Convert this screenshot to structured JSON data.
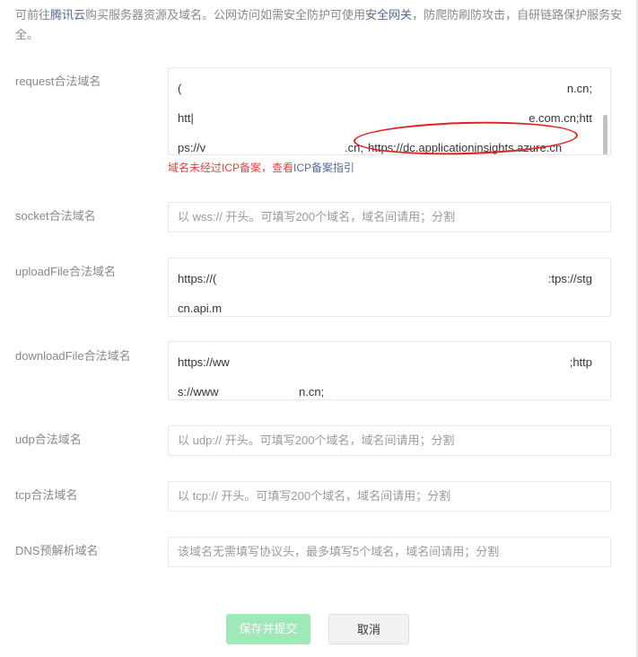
{
  "notice": {
    "prefix": "可前往",
    "link1": "腾讯云",
    "middle": "购买服务器资源及域名。公网访问如需安全防护可使用",
    "link2": "安全网关",
    "suffix": "，防爬防刷防攻击，自研链路保护服务安全。"
  },
  "request": {
    "label": "request合法域名",
    "line1_start": "(",
    "line1_end": "n.cn;",
    "line2_start": "htt|",
    "line2_end": "e.com.cn;htt",
    "line3_start": "ps://v",
    "line3_mid": ".cn;",
    "line3_highlight": "https://dc.applicationinsights.azure.cn",
    "hint_prefix": "域名未经过ICP备案，查看",
    "hint_link": "ICP备案指引"
  },
  "socket": {
    "label": "socket合法域名",
    "placeholder": "以 wss:// 开头。可填写200个域名，域名间请用；分割"
  },
  "uploadFile": {
    "label": "uploadFile合法域名",
    "line1_start": "https://(",
    "line1_end": ":tps://stg",
    "line2_start": "cn.api.m"
  },
  "downloadFile": {
    "label": "downloadFile合法域名",
    "line1_start": "https://ww",
    "line1_end": ";http",
    "line2_start": "s://www",
    "line2_end": "n.cn;"
  },
  "udp": {
    "label": "udp合法域名",
    "placeholder": "以 udp:// 开头。可填写200个域名，域名间请用；分割"
  },
  "tcp": {
    "label": "tcp合法域名",
    "placeholder": "以 tcp:// 开头。可填写200个域名，域名间请用；分割"
  },
  "dns": {
    "label": "DNS预解析域名",
    "placeholder": "该域名无需填写协议头，最多填写5个域名，域名间请用；分割"
  },
  "buttons": {
    "submit": "保存并提交",
    "cancel": "取消"
  }
}
